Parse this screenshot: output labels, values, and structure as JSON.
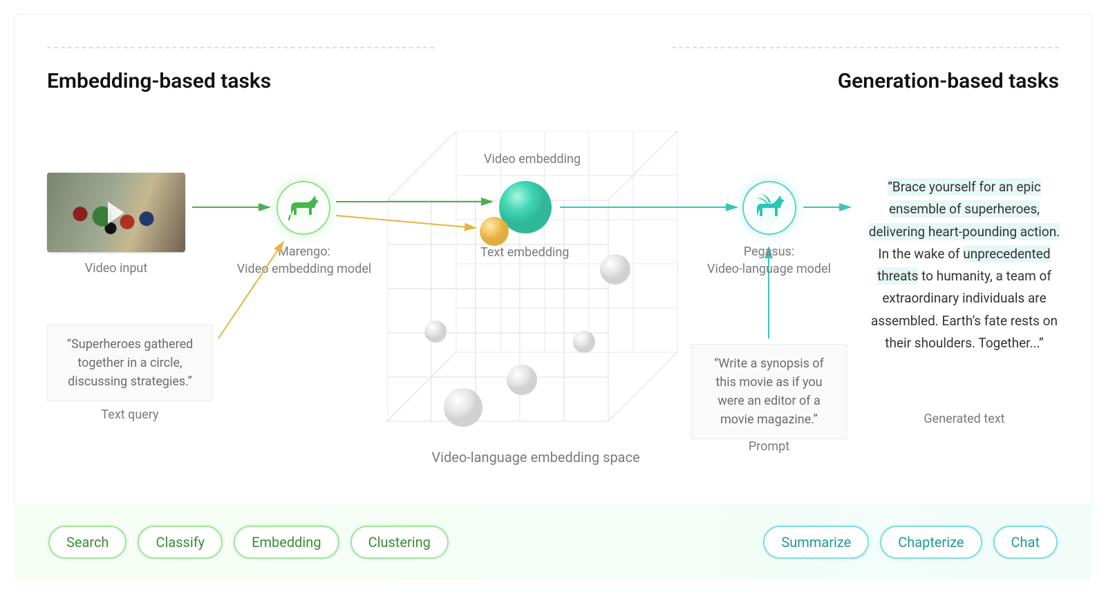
{
  "headings": {
    "left": "Embedding-based tasks",
    "right": "Generation-based tasks"
  },
  "video_input": {
    "caption": "Video input"
  },
  "text_query": {
    "text": "“Superheroes gathered together in a circle, discussing strategies.”",
    "caption": "Text query"
  },
  "marengo": {
    "label_line1": "Marengo:",
    "label_line2": "Video embedding model",
    "icon": "horse-icon"
  },
  "pegasus": {
    "label_line1": "Pegasus:",
    "label_line2": "Video-language model",
    "icon": "pegasus-icon"
  },
  "embedding_space": {
    "caption": "Video-language embedding space",
    "video_emb_label": "Video embedding",
    "text_emb_label": "Text embedding"
  },
  "prompt": {
    "text": "“Write a synopsis of this movie as if you were an editor of a movie magazine.”",
    "caption": "Prompt"
  },
  "generated": {
    "caption": "Generated text",
    "segments": [
      {
        "t": "“Brace yourself for an epic ensemble of superheroes, delivering heart-pounding action.",
        "hl": true
      },
      {
        "t": " In the wake of ",
        "hl": false
      },
      {
        "t": "unprecedented threats",
        "hl": true
      },
      {
        "t": " to humanity, a team of extraordinary individuals are assembled. Earth’s fate rests on their shoulders. Together...”",
        "hl": false
      }
    ]
  },
  "pills": {
    "left": [
      "Search",
      "Classify",
      "Embedding",
      "Clustering"
    ],
    "right": [
      "Summarize",
      "Chapterize",
      "Chat"
    ]
  },
  "colors": {
    "green": "#4caf50",
    "yellow": "#e7b53d",
    "teal": "#35c7b6"
  }
}
